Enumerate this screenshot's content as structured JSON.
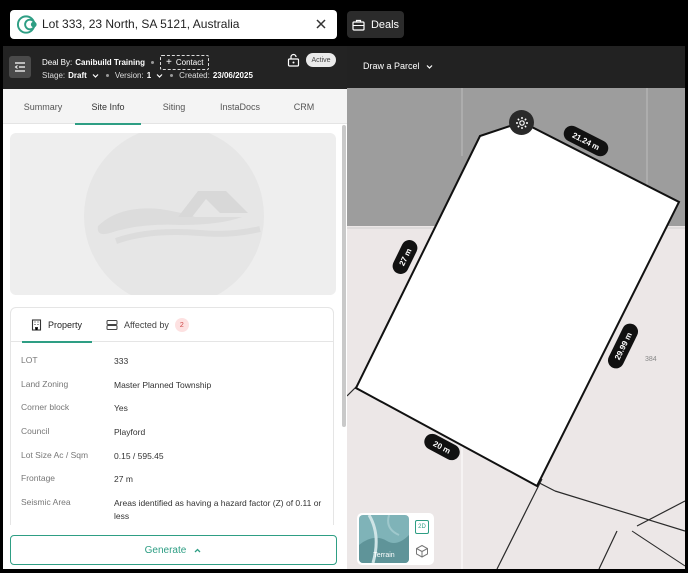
{
  "search": {
    "value": "Lot 333, 23 North, SA 5121, Australia"
  },
  "header": {
    "deals_label": "Deals"
  },
  "deal": {
    "deal_by_label": "Deal By:",
    "deal_by_value": "Canibuild Training",
    "contact_label": "Contact",
    "stage_label": "Stage:",
    "stage_value": "Draft",
    "version_label": "Version:",
    "version_value": "1",
    "created_label": "Created:",
    "created_value": "23/06/2025",
    "status": "Active"
  },
  "tabs": [
    {
      "label": "Summary"
    },
    {
      "label": "Site Info"
    },
    {
      "label": "Siting"
    },
    {
      "label": "InstaDocs"
    },
    {
      "label": "CRM"
    }
  ],
  "property_card": {
    "tab_property": "Property",
    "tab_affected": "Affected by",
    "affected_count": "2",
    "rows": [
      {
        "key": "LOT",
        "value": "333"
      },
      {
        "key": "Land Zoning",
        "value": "Master Planned Township"
      },
      {
        "key": "Corner block",
        "value": "Yes"
      },
      {
        "key": "Council",
        "value": "Playford"
      },
      {
        "key": "Lot Size Ac / Sqm",
        "value": "0.15 / 595.45"
      },
      {
        "key": "Frontage",
        "value": "27 m"
      },
      {
        "key": "Seismic Area",
        "value": "Areas identified as having a hazard factor (Z) of 0.11 or less"
      }
    ]
  },
  "generate_label": "Generate",
  "map": {
    "draw_label": "Draw a Parcel",
    "dimensions": [
      "21.24 m",
      "27 m",
      "29.99 m",
      "20 m"
    ],
    "neighbour_lot": "384",
    "terrain_label": "Terrain",
    "view_2d": "2D"
  },
  "colors": {
    "accent": "#2e9e84",
    "dark_bar": "#232323"
  }
}
